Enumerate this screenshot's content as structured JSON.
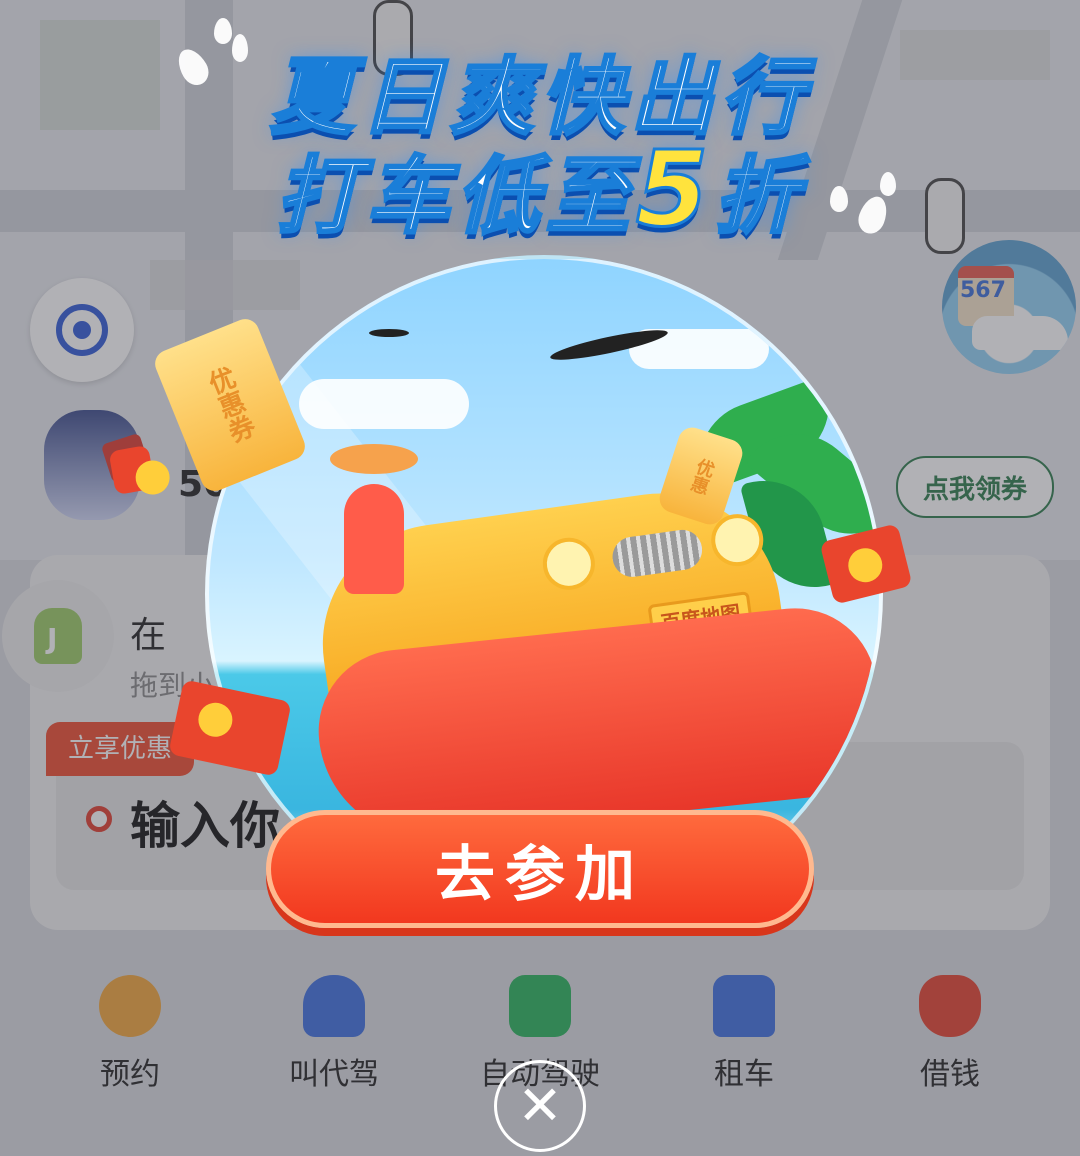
{
  "popup": {
    "headline_line1": "夏日爽快出行",
    "headline_line2_prefix": "打车低至",
    "headline_line2_highlight": "5",
    "headline_line2_suffix": "折",
    "ticket_left": "优惠券",
    "ticket_right": "优惠",
    "car_plate": "百度地图",
    "cta_label": "去参加",
    "close_symbol": "✕"
  },
  "background": {
    "promo_count": "56",
    "coupon_button": "点我领券",
    "avatar_number": "567",
    "card_title": "在",
    "card_subtitle": "拖到小",
    "tag_label": "立享优惠",
    "destination_placeholder": "输入你",
    "services": [
      {
        "label": "预约",
        "icon": "stopwatch-icon",
        "color": "#f3a63a"
      },
      {
        "label": "叫代驾",
        "icon": "driver-icon",
        "color": "#3d6fe0"
      },
      {
        "label": "自动驾驶",
        "icon": "autonomous-icon",
        "color": "#27b35a"
      },
      {
        "label": "租车",
        "icon": "rental-car-icon",
        "color": "#3d6fe0"
      },
      {
        "label": "借钱",
        "icon": "money-bag-icon",
        "color": "#e6412e"
      }
    ]
  },
  "colors": {
    "headline_stroke": "#1a7ed8",
    "highlight": "#ffe33d",
    "cta": "#f2381f"
  }
}
